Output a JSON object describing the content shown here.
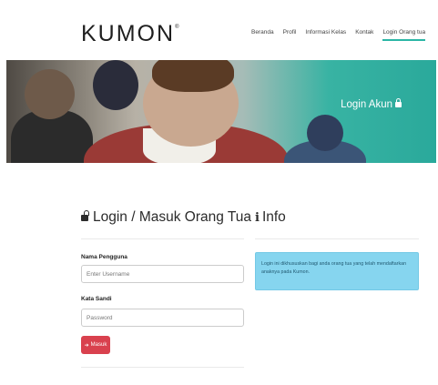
{
  "header": {
    "logo_text": "KUMON",
    "logo_mark": "®",
    "nav": [
      {
        "label": "Beranda"
      },
      {
        "label": "Profil"
      },
      {
        "label": "Informasi Kelas"
      },
      {
        "label": "Kontak"
      },
      {
        "label": "Login Orang tua",
        "active": true
      }
    ]
  },
  "banner": {
    "title": "Login Akun",
    "icon": "lock-icon"
  },
  "login": {
    "title": "Login / Masuk Orang Tua",
    "icon": "unlock-icon",
    "username_label": "Nama Pengguna",
    "username_placeholder": "Enter Username",
    "username_value": "",
    "password_label": "Kata Sandi",
    "password_placeholder": "Password",
    "password_value": "",
    "submit_label": "Masuk",
    "submit_icon": "sign-in-icon"
  },
  "info": {
    "title": "Info",
    "icon": "info-icon",
    "message": "Login ini dikhususkan bagi anda orang tua yang telah mendaftarkan anaknya pada Kumon."
  },
  "colors": {
    "accent": "#2bb6a5",
    "button": "#d9414e",
    "info_box": "#86d5ef"
  }
}
